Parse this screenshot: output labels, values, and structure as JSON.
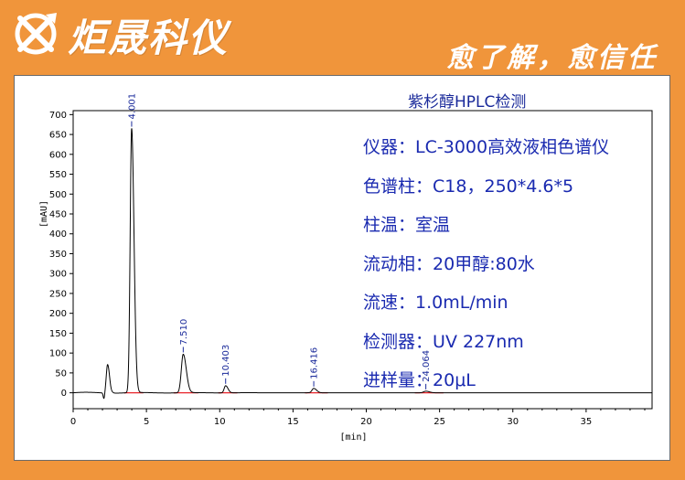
{
  "brand": {
    "name": "炬晟科仪",
    "slogan": "愈了解，愈信任",
    "colors": {
      "background": "#f0953b",
      "text": "#ffffff"
    }
  },
  "chart_data": {
    "type": "line",
    "title": "紫杉醇HPLC检测",
    "xlabel": "[min]",
    "ylabel": "[mAU]",
    "xlim": [
      0,
      39.5
    ],
    "ylim": [
      -40,
      710
    ],
    "xticks": [
      0,
      5,
      10,
      15,
      20,
      25,
      30,
      35
    ],
    "yticks": [
      0,
      50,
      100,
      150,
      200,
      250,
      300,
      350,
      400,
      450,
      500,
      550,
      600,
      650,
      700
    ],
    "grid": false,
    "line_color": "#000000",
    "baseline_color": "#e8232a",
    "label_color": "#1a2a9a",
    "peaks": [
      {
        "rt": 2.35,
        "height": 72,
        "width": 0.09,
        "label": ""
      },
      {
        "rt": 3.99,
        "height": 665,
        "width": 0.1,
        "label": "4.001"
      },
      {
        "rt": 7.51,
        "height": 97,
        "width": 0.13,
        "label": "7.510"
      },
      {
        "rt": 10.403,
        "height": 18,
        "width": 0.1,
        "label": "10.403"
      },
      {
        "rt": 16.416,
        "height": 11,
        "width": 0.12,
        "label": "16.416"
      },
      {
        "rt": 24.064,
        "height": 4,
        "width": 0.15,
        "label": "24.064"
      }
    ],
    "dips": [
      {
        "rt": 2.1,
        "depth": -15,
        "width": 0.05
      },
      {
        "rt": 2.55,
        "depth": -6,
        "width": 0.08
      }
    ]
  },
  "conditions": [
    {
      "label": "仪器",
      "sep": "：",
      "value": "LC-3000高效液相色谱仪"
    },
    {
      "label": "色谱柱",
      "sep": "：",
      "value": "C18，250*4.6*5"
    },
    {
      "label": "柱温",
      "sep": "：",
      "value": "室温"
    },
    {
      "label": "流动相",
      "sep": "：",
      "value": "20甲醇:80水"
    },
    {
      "label": "流速",
      "sep": "：",
      "value": "1.0mL/min"
    },
    {
      "label": "检测器",
      "sep": "：",
      "value": "UV 227nm"
    },
    {
      "label": "进样量",
      "sep": "：",
      "value": "20μL"
    }
  ]
}
